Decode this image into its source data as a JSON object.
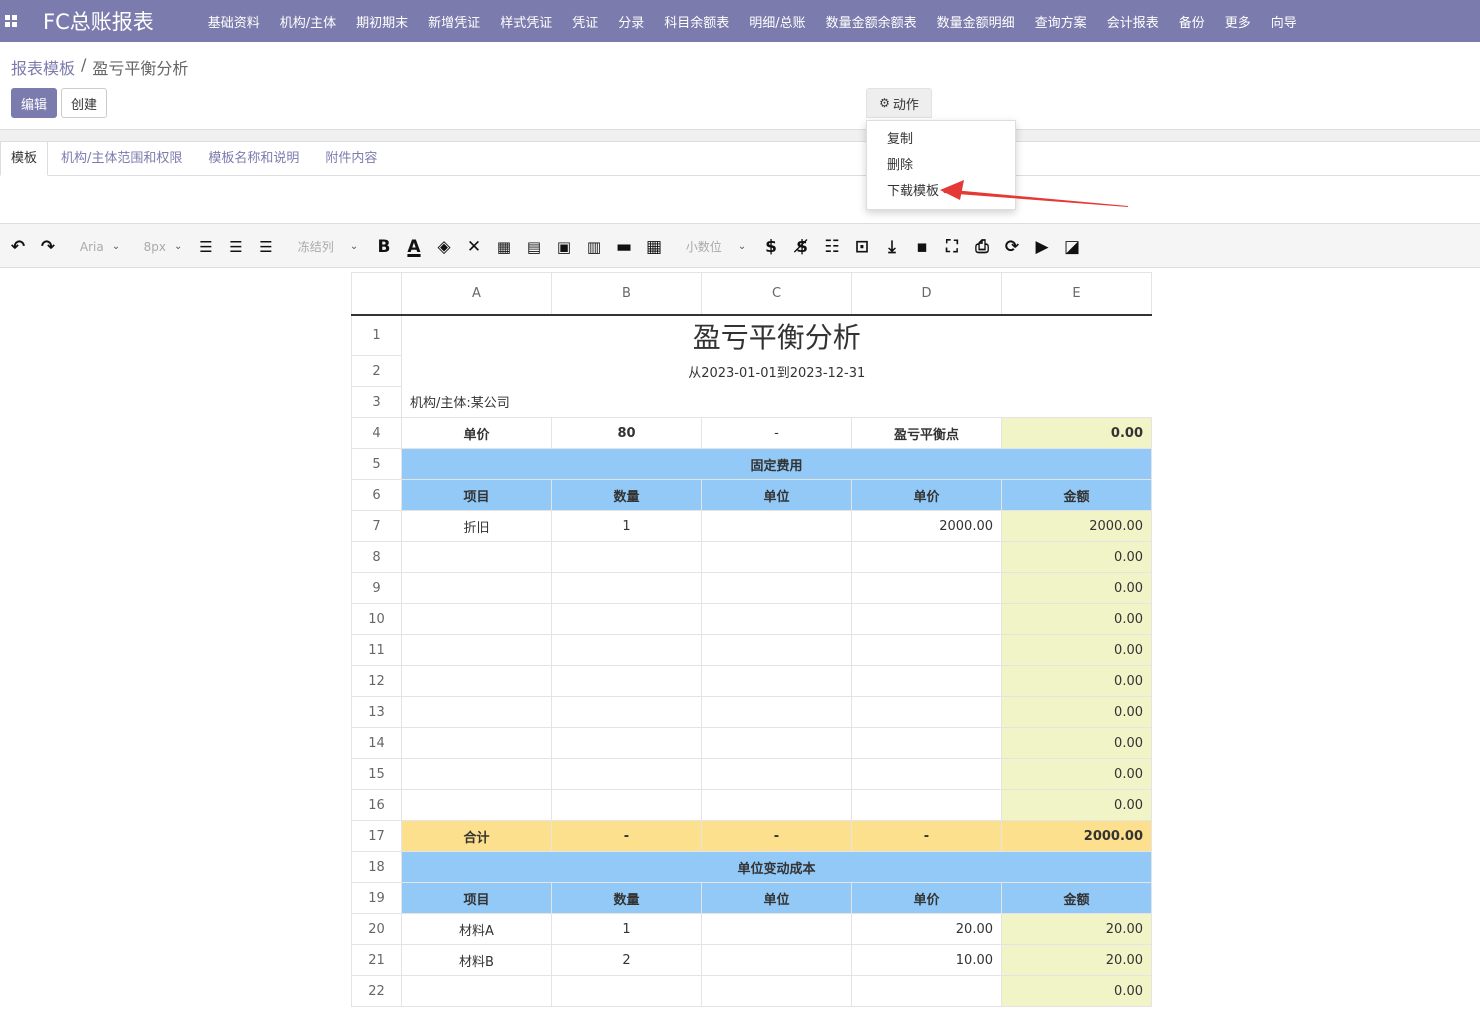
{
  "topbar": {
    "brand": "FC总账报表",
    "menu": [
      "基础资料",
      "机构/主体",
      "期初期末",
      "新增凭证",
      "样式凭证",
      "凭证",
      "分录",
      "科目余额表",
      "明细/总账",
      "数量金额余额表",
      "数量金额明细",
      "查询方案",
      "会计报表",
      "备份",
      "更多",
      "向导"
    ]
  },
  "breadcrumb": {
    "parent": "报表模板",
    "sep": "/",
    "current": "盈亏平衡分析"
  },
  "buttons": {
    "edit": "编辑",
    "create": "创建",
    "action": "动作"
  },
  "tabs": [
    "模板",
    "机构/主体范围和权限",
    "模板名称和说明",
    "附件内容"
  ],
  "dropdown": {
    "items": [
      "复制",
      "删除",
      "下载模板"
    ]
  },
  "toolbar": {
    "font": "Aria",
    "size": "8px",
    "freeze": "冻结列",
    "decimal": "小数位"
  },
  "sheet": {
    "columns": [
      "A",
      "B",
      "C",
      "D",
      "E"
    ],
    "title": "盈亏平衡分析",
    "period": "从2023-01-01到2023-12-31",
    "org": "机构/主体:某公司",
    "row4": [
      "单价",
      "80",
      "-",
      "盈亏平衡点",
      "0.00"
    ],
    "fixed_header": "固定费用",
    "col_headers": [
      "项目",
      "数量",
      "单位",
      "单价",
      "金额"
    ],
    "fixed_rows": [
      [
        "折旧",
        "1",
        "",
        "2000.00",
        "2000.00"
      ],
      [
        "",
        "",
        "",
        "",
        "0.00"
      ],
      [
        "",
        "",
        "",
        "",
        "0.00"
      ],
      [
        "",
        "",
        "",
        "",
        "0.00"
      ],
      [
        "",
        "",
        "",
        "",
        "0.00"
      ],
      [
        "",
        "",
        "",
        "",
        "0.00"
      ],
      [
        "",
        "",
        "",
        "",
        "0.00"
      ],
      [
        "",
        "",
        "",
        "",
        "0.00"
      ],
      [
        "",
        "",
        "",
        "",
        "0.00"
      ],
      [
        "",
        "",
        "",
        "",
        "0.00"
      ]
    ],
    "total_row": [
      "合计",
      "-",
      "-",
      "-",
      "2000.00"
    ],
    "variable_header": "单位变动成本",
    "variable_rows": [
      [
        "材料A",
        "1",
        "",
        "20.00",
        "20.00"
      ],
      [
        "材料B",
        "2",
        "",
        "10.00",
        "20.00"
      ],
      [
        "",
        "",
        "",
        "",
        "0.00"
      ]
    ]
  },
  "colors": {
    "brand": "#7c7bad",
    "blue_header": "#92c9f6",
    "total": "#fde08d",
    "amount": "#f1f4c7",
    "arrow": "#e53935"
  }
}
